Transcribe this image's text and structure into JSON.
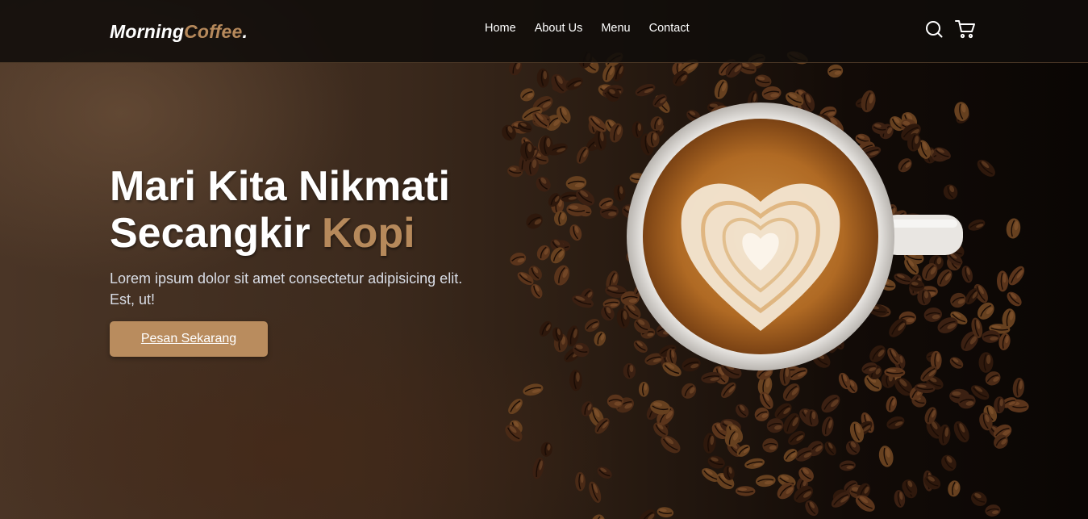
{
  "brand": {
    "name_main": "Morning",
    "name_accent": "Coffee",
    "name_dot": "."
  },
  "nav": {
    "links": [
      "Home",
      "About Us",
      "Menu",
      "Contact"
    ]
  },
  "icons": {
    "search": "search-icon",
    "cart": "shopping-cart-icon"
  },
  "hero": {
    "headline_line1": "Mari Kita Nikmati",
    "headline_line2": "Secangkir",
    "headline_accent": "Kopi",
    "description": "Lorem ipsum dolor sit amet consectetur adipisicing elit. Est, ut!",
    "cta_label": "Pesan Sekarang"
  },
  "colors": {
    "accent": "#b6895b",
    "button": "#b98c5e",
    "nav_bg": "#100c0a"
  }
}
